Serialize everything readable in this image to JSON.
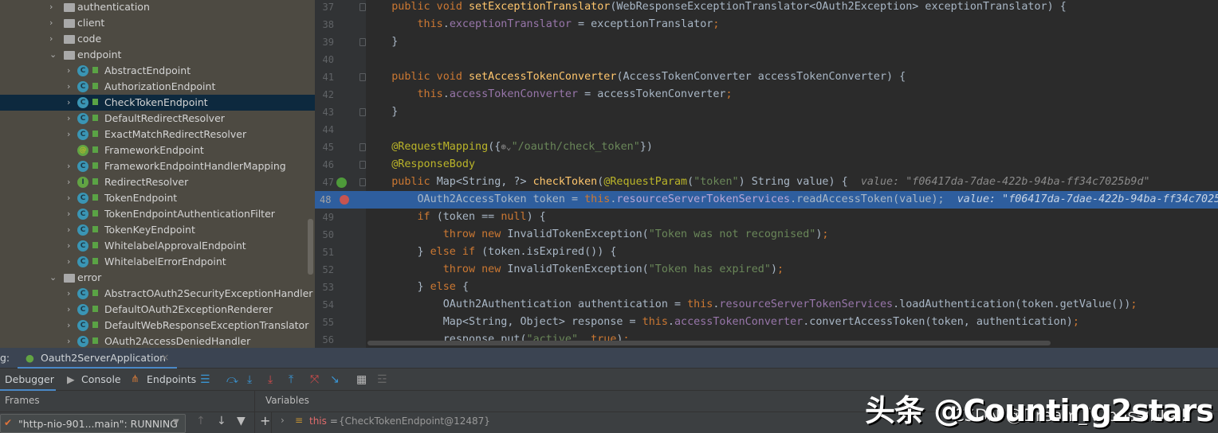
{
  "project_tree": [
    {
      "label": "authentication",
      "kind": "folder",
      "level": 0,
      "expanded": false
    },
    {
      "label": "client",
      "kind": "folder",
      "level": 0,
      "expanded": false
    },
    {
      "label": "code",
      "kind": "folder",
      "level": 0,
      "expanded": false
    },
    {
      "label": "endpoint",
      "kind": "folder",
      "level": 0,
      "expanded": true
    },
    {
      "label": "AbstractEndpoint",
      "kind": "class",
      "level": 1
    },
    {
      "label": "AuthorizationEndpoint",
      "kind": "class",
      "level": 1
    },
    {
      "label": "CheckTokenEndpoint",
      "kind": "class",
      "level": 1,
      "selected": true
    },
    {
      "label": "DefaultRedirectResolver",
      "kind": "class",
      "level": 1
    },
    {
      "label": "ExactMatchRedirectResolver",
      "kind": "class",
      "level": 1
    },
    {
      "label": "FrameworkEndpoint",
      "kind": "annotation",
      "level": 1,
      "leaf": true
    },
    {
      "label": "FrameworkEndpointHandlerMapping",
      "kind": "class",
      "level": 1
    },
    {
      "label": "RedirectResolver",
      "kind": "interface",
      "level": 1
    },
    {
      "label": "TokenEndpoint",
      "kind": "class",
      "level": 1
    },
    {
      "label": "TokenEndpointAuthenticationFilter",
      "kind": "class",
      "level": 1
    },
    {
      "label": "TokenKeyEndpoint",
      "kind": "class",
      "level": 1
    },
    {
      "label": "WhitelabelApprovalEndpoint",
      "kind": "class",
      "level": 1
    },
    {
      "label": "WhitelabelErrorEndpoint",
      "kind": "class",
      "level": 1
    },
    {
      "label": "error",
      "kind": "folder",
      "level": 0,
      "expanded": true
    },
    {
      "label": "AbstractOAuth2SecurityExceptionHandler",
      "kind": "class",
      "level": 1
    },
    {
      "label": "DefaultOAuth2ExceptionRenderer",
      "kind": "class",
      "level": 1
    },
    {
      "label": "DefaultWebResponseExceptionTranslator",
      "kind": "class",
      "level": 1
    },
    {
      "label": "OAuth2AccessDeniedHandler",
      "kind": "class",
      "level": 1
    }
  ],
  "editor": {
    "current_line": 48,
    "lines": [
      {
        "n": 37,
        "tokens": [
          [
            "    "
          ],
          [
            "public void ",
            "kw"
          ],
          [
            "setExceptionTranslator",
            "fn"
          ],
          [
            "(WebResponseExceptionTranslator<OAuth2Exception> exceptionTranslator) {"
          ]
        ]
      },
      {
        "n": 38,
        "tokens": [
          [
            "        "
          ],
          [
            "this",
            "kw"
          ],
          [
            "."
          ],
          [
            "exceptionTranslator",
            "field"
          ],
          [
            " = exceptionTranslator"
          ],
          [
            ";",
            "kw"
          ]
        ]
      },
      {
        "n": 39,
        "tokens": [
          [
            "    }"
          ]
        ]
      },
      {
        "n": 40,
        "tokens": []
      },
      {
        "n": 41,
        "tokens": [
          [
            "    "
          ],
          [
            "public void ",
            "kw"
          ],
          [
            "setAccessTokenConverter",
            "fn"
          ],
          [
            "(AccessTokenConverter accessTokenConverter) {"
          ]
        ]
      },
      {
        "n": 42,
        "tokens": [
          [
            "        "
          ],
          [
            "this",
            "kw"
          ],
          [
            "."
          ],
          [
            "accessTokenConverter",
            "field"
          ],
          [
            " = accessTokenConverter"
          ],
          [
            ";",
            "kw"
          ]
        ]
      },
      {
        "n": 43,
        "tokens": [
          [
            "    }"
          ]
        ]
      },
      {
        "n": 44,
        "tokens": []
      },
      {
        "n": 45,
        "tokens": [
          [
            "    "
          ],
          [
            "@RequestMapping",
            "ann"
          ],
          [
            "({"
          ],
          [
            "⊕⌄",
            "globe"
          ],
          [
            "\"/oauth/check_token\"",
            "str"
          ],
          [
            "})"
          ]
        ]
      },
      {
        "n": 46,
        "tokens": [
          [
            "    "
          ],
          [
            "@ResponseBody",
            "ann"
          ]
        ]
      },
      {
        "n": 47,
        "tokens": [
          [
            "    "
          ],
          [
            "public ",
            "kw"
          ],
          [
            "Map<String, ?> "
          ],
          [
            "checkToken",
            "fn"
          ],
          [
            "("
          ],
          [
            "@RequestParam",
            "ann"
          ],
          [
            "("
          ],
          [
            "\"token\"",
            "str"
          ],
          [
            ") String value) {  "
          ],
          [
            "value: \"f06417da-7dae-422b-94ba-ff34c7025b9d\"",
            "hint"
          ]
        ]
      },
      {
        "n": 48,
        "tokens": [
          [
            "        OAuth2AccessToken token = "
          ],
          [
            "this",
            "kw"
          ],
          [
            "."
          ],
          [
            "resourceServerTokenServices",
            "field"
          ],
          [
            ".readAccessToken(value);  "
          ],
          [
            "value: \"f06417da-7dae-422b-94ba-ff34c7025",
            "hint"
          ]
        ]
      },
      {
        "n": 49,
        "tokens": [
          [
            "        "
          ],
          [
            "if ",
            "kw"
          ],
          [
            "(token == "
          ],
          [
            "null",
            "kw"
          ],
          [
            ") {"
          ]
        ]
      },
      {
        "n": 50,
        "tokens": [
          [
            "            "
          ],
          [
            "throw new ",
            "kw"
          ],
          [
            "InvalidTokenException("
          ],
          [
            "\"Token was not recognised\"",
            "str"
          ],
          [
            ")"
          ],
          [
            ";",
            "kw"
          ]
        ]
      },
      {
        "n": 51,
        "tokens": [
          [
            "        } "
          ],
          [
            "else if ",
            "kw"
          ],
          [
            "(token.isExpired()) {"
          ]
        ]
      },
      {
        "n": 52,
        "tokens": [
          [
            "            "
          ],
          [
            "throw new ",
            "kw"
          ],
          [
            "InvalidTokenException("
          ],
          [
            "\"Token has expired\"",
            "str"
          ],
          [
            ")"
          ],
          [
            ";",
            "kw"
          ]
        ]
      },
      {
        "n": 53,
        "tokens": [
          [
            "        } "
          ],
          [
            "else ",
            "kw"
          ],
          [
            "{"
          ]
        ]
      },
      {
        "n": 54,
        "tokens": [
          [
            "            OAuth2Authentication authentication = "
          ],
          [
            "this",
            "kw"
          ],
          [
            "."
          ],
          [
            "resourceServerTokenServices",
            "field"
          ],
          [
            ".loadAuthentication(token.getValue())"
          ],
          [
            ";",
            "kw"
          ]
        ]
      },
      {
        "n": 55,
        "tokens": [
          [
            "            Map<String, Object> response = "
          ],
          [
            "this",
            "kw"
          ],
          [
            "."
          ],
          [
            "accessTokenConverter",
            "field"
          ],
          [
            ".convertAccessToken(token, authentication)"
          ],
          [
            ";",
            "kw"
          ]
        ]
      },
      {
        "n": 56,
        "tokens": [
          [
            "            response.put("
          ],
          [
            "\"active\"",
            "str"
          ],
          [
            ", "
          ],
          [
            "true",
            "kw"
          ],
          [
            ")"
          ],
          [
            ";",
            "kw"
          ]
        ]
      }
    ]
  },
  "debug": {
    "prefix": "g:",
    "session_tab": "Oauth2ServerApplication",
    "tabs": [
      "Debugger",
      "Console",
      "Endpoints"
    ],
    "frames_label": "Frames",
    "variables_label": "Variables",
    "thread_select": "\"http-nio-901...main\": RUNNING",
    "variable_this_name": "this",
    "variable_this_eq": " = ",
    "variable_this_value": "{CheckTokenEndpoint@12487}"
  },
  "watermark": {
    "toutiao": "头条 @Counting2stars",
    "csdn": "CSDN @Dream_it_possible !"
  },
  "colors": {
    "tree_bg": "#4d4a42",
    "selection": "#0d293e",
    "editor_bg": "#2b2b2b",
    "current_line": "#2e5e9e",
    "keyword": "#cc7832",
    "string": "#6a8759",
    "field": "#9876aa",
    "method": "#ffc66d",
    "annotation": "#bbb529"
  }
}
